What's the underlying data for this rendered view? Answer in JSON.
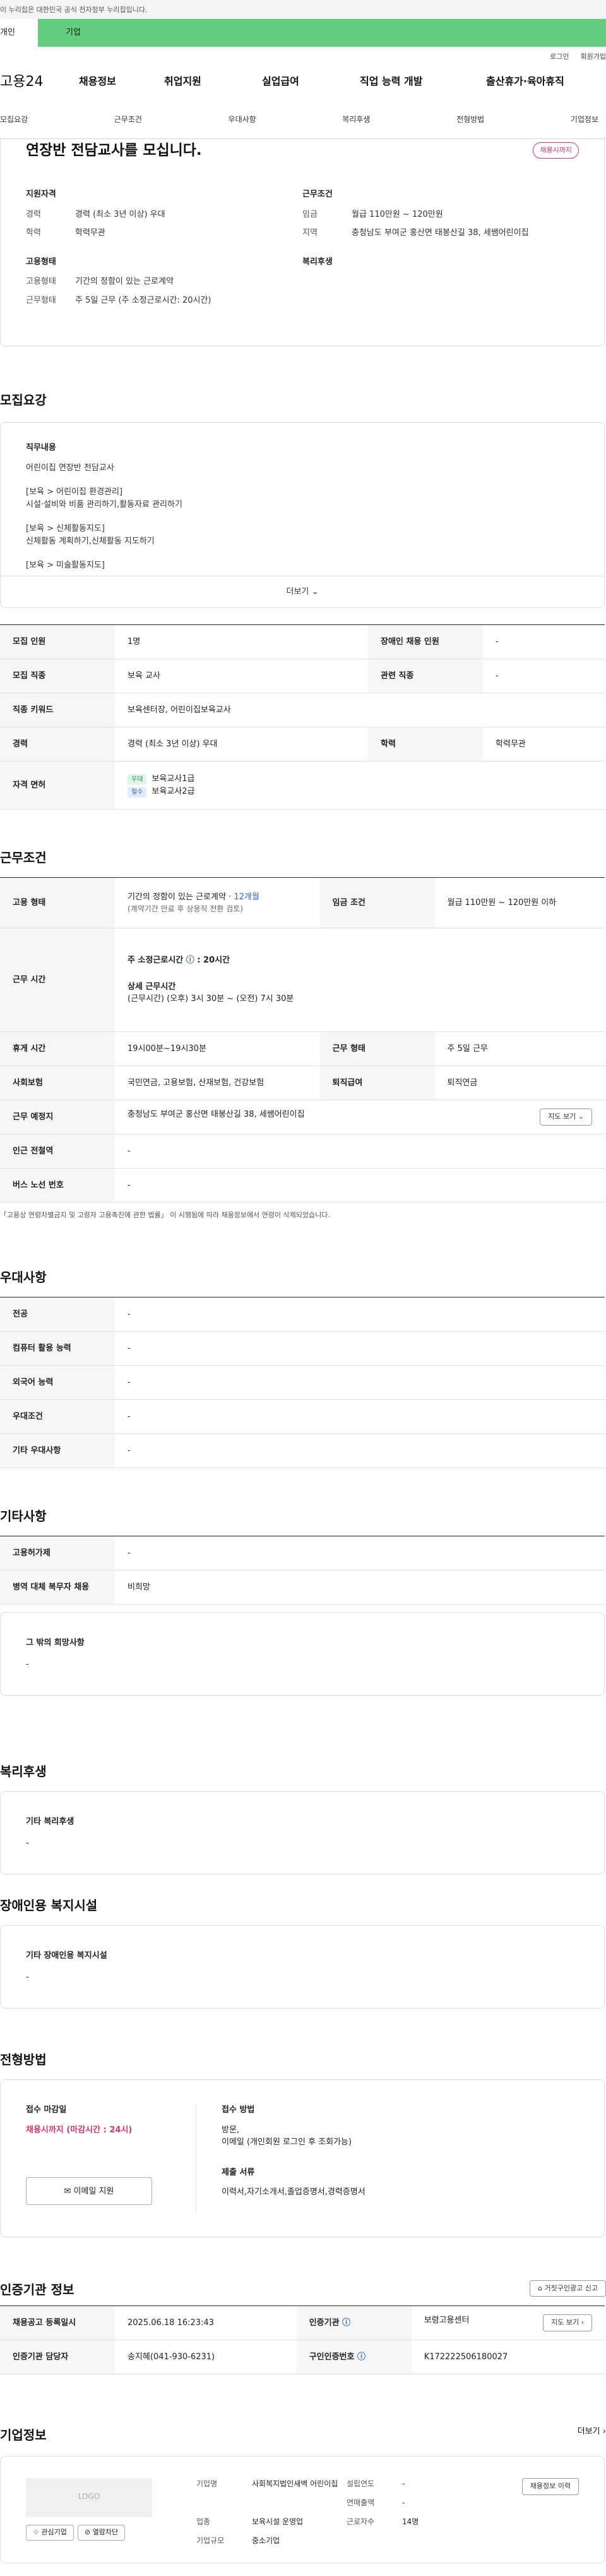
{
  "gov": "이 누리집은 대한민국 공식 전자정부 누리집입니다.",
  "tabs": {
    "personal": "개인",
    "enterprise": "기업"
  },
  "util": {
    "login": "로그인",
    "join": "회원가입"
  },
  "gnb": {
    "logo": "고용24",
    "menu": [
      "채용정보",
      "취업지원",
      "실업급여",
      "직업 능력 개발",
      "출산휴가·육아휴직"
    ]
  },
  "lnb": [
    "모집요강",
    "근무조건",
    "우대사항",
    "복리후생",
    "전형방법",
    "기업정보"
  ],
  "top": {
    "title": "연장반 전담교사를 모십니다.",
    "badge": "채용시까지",
    "qual": {
      "h": "지원자격",
      "rows": [
        [
          "경력",
          "경력 (최소 3년 이상) 우대"
        ],
        [
          "학력",
          "학력무관"
        ]
      ]
    },
    "cond": {
      "h": "근무조건",
      "rows": [
        [
          "임금",
          "월급 110만원 ~ 120만원"
        ],
        [
          "지역",
          "충청남도 부여군 홍산면 태봉산길 38, 세쌤어린이집"
        ]
      ]
    },
    "emp": {
      "h": "고용형태",
      "rows": [
        [
          "고용형태",
          "기간의 정함이 있는 근로계약"
        ],
        [
          "근무형태",
          "주 5일 근무 (주 소정근로시간: 20시간)"
        ]
      ]
    },
    "welfare": {
      "h": "복리후생"
    }
  },
  "recruit": {
    "title": "모집요강",
    "duty_h": "직무내용",
    "lines": [
      "어린이집 연장반 전담교사",
      "",
      "[보육 > 어린이집 환경관리]",
      "시설·설비와 비품 관리하기,활동자료 관리하기",
      "",
      "[보육 > 신체활동지도]",
      "신체활동 계획하기,신체활동 지도하기",
      "",
      "[보육 > 미술활동지도]"
    ],
    "more": "더보기",
    "table": {
      "h1": "모집 인원",
      "v1": "1명",
      "h2": "장애인 채용 인원",
      "v2": "-",
      "h3": "모집 직종",
      "v3": "보육 교사",
      "h4": "관련 직종",
      "v4": "-",
      "h5": "직종 키워드",
      "v5": "보육센터장, 어린이집보육교사",
      "h6": "경력",
      "v6": "경력 (최소 3년 이상) 우대",
      "h7": "학력",
      "v7": "학력무관",
      "h8": "자격 면허",
      "c1": "우대",
      "l1": "보육교사1급",
      "c2": "필수",
      "l2": "보육교사2급"
    }
  },
  "work": {
    "title": "근무조건",
    "h1": "고용 형태",
    "v1a": "기간의 정함이 있는 근로계약 · ",
    "v1b": "12개월",
    "v1c": "(계약기간 만료 후 상용직 전환 검토)",
    "h2": "임금 조건",
    "v2": "월급 110만원 ~ 120만원 이하",
    "h3": "근무 시간",
    "v3a": "주 소정근로시간",
    "v3b": ": 20시간",
    "v3c": "상세 근무시간",
    "v3d": "(근무시간) (오후) 3시 30분 ~ (오전) 7시 30분",
    "h4": "휴게 시간",
    "v4": "19시00분~19시30분",
    "h5": "근무 형태",
    "v5": "주 5일 근무",
    "h6": "사회보험",
    "v6": "국민연금, 고용보험, 산재보험, 건강보험",
    "h7": "퇴직급여",
    "v7": "퇴직연금",
    "h8": "근무 예정지",
    "v8": "충청남도 부여군 홍산면 태봉산길 38, 세쌤어린이집",
    "map": "지도 보기",
    "h9": "인근 전철역",
    "v9": "-",
    "h10": "버스 노선 번호",
    "v10": "-",
    "note": "「고용상 연령차별금지 및 고령자 고용촉진에 관한 법률」 이 시행됨에 따라 채용정보에서 연령이 삭제되었습니다."
  },
  "pref": {
    "title": "우대사항",
    "rows": [
      [
        "전공",
        "-"
      ],
      [
        "컴퓨터 활용 능력",
        "-"
      ],
      [
        "외국어 능력",
        "-"
      ],
      [
        "우대조건",
        "-"
      ],
      [
        "기타 우대사항",
        "-"
      ]
    ]
  },
  "etc": {
    "title": "기타사항",
    "rows": [
      [
        "고용허가제",
        "-"
      ],
      [
        "병역 대체 복무자 채용",
        "비희망"
      ]
    ],
    "hope_h": "그 밖의 희망사항",
    "hope_v": "-"
  },
  "benefit": {
    "title": "복리후생",
    "h": "기타 복리후생",
    "v": "-"
  },
  "disab": {
    "title": "장애인용 복지시설",
    "h": "기타 장애인용 복지시설",
    "v": "-"
  },
  "select": {
    "title": "전형방법",
    "dl_h": "접수 마감일",
    "dl_v": "채용시까지 (마감시간 : 24시)",
    "mail": "이메일 지원",
    "method_h": "접수 방법",
    "method_v1": "방문,",
    "method_v2": "이메일 (개인회원 로그인 후 조회가능)",
    "docs_h": "제출 서류",
    "docs_v": "이력서,자기소개서,졸업증명서,경력증명서"
  },
  "agency": {
    "title": "인증기관 정보",
    "report": "거짓구인광고 신고",
    "h1": "채용공고 등록일시",
    "v1": "2025.06.18 16:23:43",
    "h2": "인증기관",
    "v2": "보령고용센터",
    "map": "지도 보기",
    "h3": "인증기관 담당자",
    "v3": "송지혜(041-930-6231)",
    "h4": "구인인증번호",
    "v4": "K172222506180027"
  },
  "company": {
    "title": "기업정보",
    "more": "더보기",
    "logo": "LOGO",
    "fav": "관심기업",
    "block": "열람차단",
    "rows": [
      [
        "기업명",
        "사회복지법인새벽 어린이집"
      ],
      [
        "설립연도",
        "-"
      ],
      [
        "연매출액",
        "-"
      ],
      [
        "업종",
        "보육시설 운영업"
      ],
      [
        "근로자수",
        "14명"
      ],
      [
        "기업규모",
        "중소기업"
      ]
    ],
    "jobs": "채용정보 이력"
  }
}
